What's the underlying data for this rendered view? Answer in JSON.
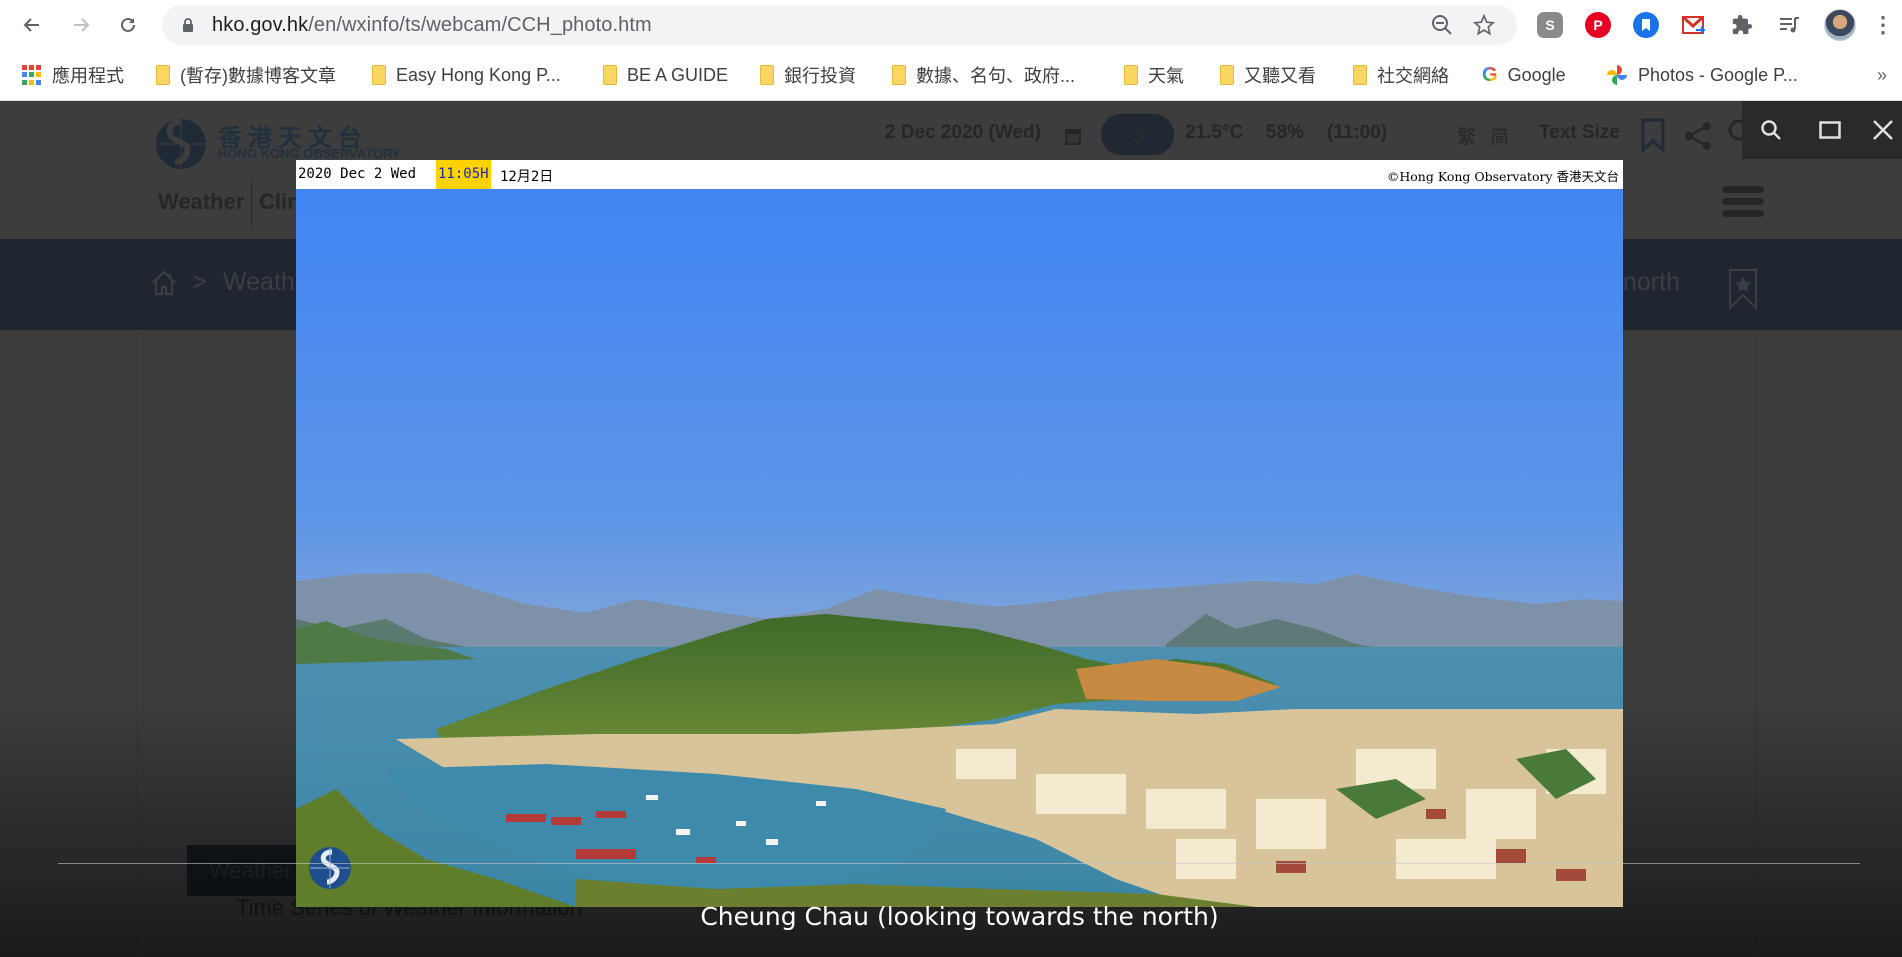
{
  "browser": {
    "url_host": "hko.gov.hk",
    "url_path": "/en/wxinfo/ts/webcam/CCH_photo.htm",
    "bookmarks": [
      {
        "label": "應用程式",
        "type": "apps"
      },
      {
        "label": "(暫存)數據博客文章",
        "type": "folder"
      },
      {
        "label": "Easy Hong Kong P...",
        "type": "folder"
      },
      {
        "label": "BE A GUIDE",
        "type": "folder"
      },
      {
        "label": "銀行投資",
        "type": "folder"
      },
      {
        "label": "數據、名句、政府...",
        "type": "folder"
      },
      {
        "label": "天氣",
        "type": "folder"
      },
      {
        "label": "又聽又看",
        "type": "folder"
      },
      {
        "label": "社交網絡",
        "type": "folder"
      },
      {
        "label": "Google",
        "type": "google"
      },
      {
        "label": "Photos - Google P...",
        "type": "photos"
      }
    ],
    "overflow_label": "»",
    "extensions": [
      "skype-icon",
      "pinterest-icon",
      "bookmark-ext-icon",
      "gmail-ext-icon",
      "puzzle-icon",
      "media-icon",
      "profile-avatar",
      "menu-icon"
    ]
  },
  "site": {
    "logo_zh": "香港天文台",
    "logo_en": "HONG KONG OBSERVATORY",
    "date": "2 Dec 2020 (Wed)",
    "temperature": "21.5°C",
    "humidity": "58%",
    "obs_time": "(11:00)",
    "lang_trad": "繁",
    "lang_simp": "简",
    "text_size": "Text Size",
    "nav": [
      "Weather",
      "Clin"
    ],
    "breadcrumb": {
      "first": "Weath",
      "separator": ">",
      "last": "north"
    },
    "weather_button": "Weather",
    "section_heading": "Time Series of Weather Information"
  },
  "lightbox": {
    "timestamp": {
      "date": "2020 Dec 2 Wed",
      "time": "11:05H",
      "date_zh": "12月2日"
    },
    "copyright": "©Hong Kong Observatory 香港天文台",
    "caption": "Cheung Chau (looking towards the north)",
    "toolbar": [
      "zoom-icon",
      "fullscreen-icon",
      "close-icon"
    ]
  },
  "colors": {
    "time_highlight": "#ffd200",
    "time_text": "#1a2aa0",
    "breadcrumb_bg": "#1f2630",
    "overlay_bg": "#3c3c3c"
  }
}
